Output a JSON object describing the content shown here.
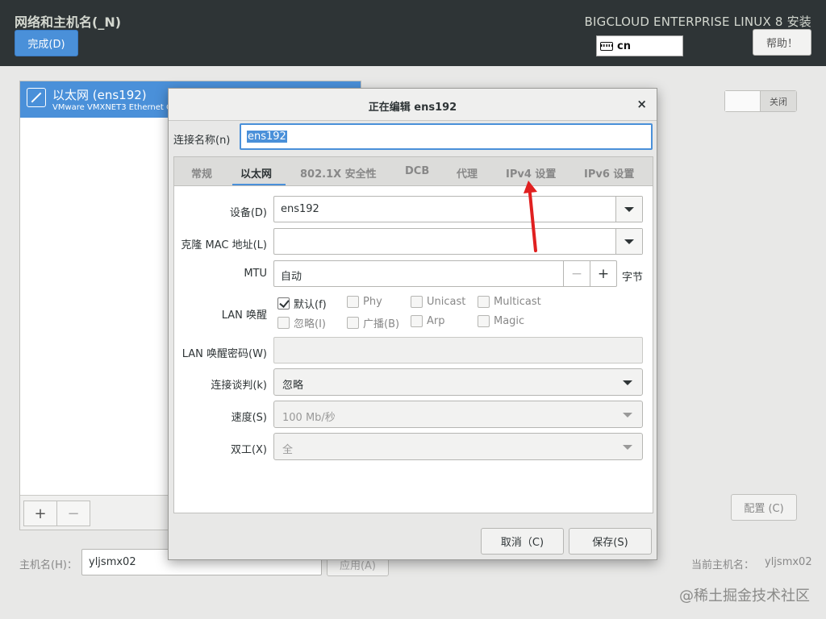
{
  "header": {
    "title": "网络和主机名(_N)",
    "done_label": "完成(D)",
    "product": "BIGCLOUD ENTERPRISE LINUX 8 安装",
    "keyboard_layout": "cn",
    "help_label": "帮助！"
  },
  "devices": {
    "items": [
      {
        "name": "以太网 (ens192)",
        "desc": "VMware VMXNET3 Ethernet C"
      }
    ],
    "add_label": "+",
    "remove_label": "−"
  },
  "toggle": {
    "state_label": "关闭"
  },
  "config_label": "配置 (C)",
  "hostname": {
    "label": "主机名(H)：",
    "value": "yljsmx02",
    "apply_label": "应用(A)",
    "current_label": "当前主机名：",
    "current_value": "yljsmx02"
  },
  "watermark": "@稀土掘金技术社区",
  "dialog": {
    "title": "正在编辑 ens192",
    "close_icon": "×",
    "conn_name_label": "连接名称(n)",
    "conn_name_value": "ens192",
    "tabs": [
      {
        "label": "常规"
      },
      {
        "label": "以太网"
      },
      {
        "label": "802.1X 安全性"
      },
      {
        "label": "DCB"
      },
      {
        "label": "代理"
      },
      {
        "label": "IPv4 设置"
      },
      {
        "label": "IPv6 设置"
      }
    ],
    "active_tab": "以太网",
    "fields": {
      "device_label": "设备(D)",
      "device_value": "ens192",
      "clone_mac_label": "克隆 MAC 地址(L)",
      "clone_mac_value": "",
      "mtu_label": "MTU",
      "mtu_value": "自动",
      "mtu_minus": "−",
      "mtu_plus": "+",
      "mtu_unit": "字节",
      "wol_label": "LAN 唤醒",
      "wol_options": [
        {
          "label": "默认(f)",
          "checked": true
        },
        {
          "label": "Phy",
          "checked": false
        },
        {
          "label": "Unicast",
          "checked": false
        },
        {
          "label": "Multicast",
          "checked": false
        },
        {
          "label": "忽略(I)",
          "checked": false
        },
        {
          "label": "广播(B)",
          "checked": false
        },
        {
          "label": "Arp",
          "checked": false
        },
        {
          "label": "Magic",
          "checked": false
        }
      ],
      "wol_password_label": "LAN 唤醒密码(W)",
      "negotiation_label": "连接谈判(k)",
      "negotiation_value": "忽略",
      "speed_label": "速度(S)",
      "speed_value": "100 Mb/秒",
      "duplex_label": "双工(X)",
      "duplex_value": "全"
    },
    "cancel_label": "取消（C)",
    "save_label": "保存(S)"
  },
  "colors": {
    "accent": "#4a90d9",
    "header_bg": "#2e3436",
    "annotation_arrow": "#e02020"
  }
}
